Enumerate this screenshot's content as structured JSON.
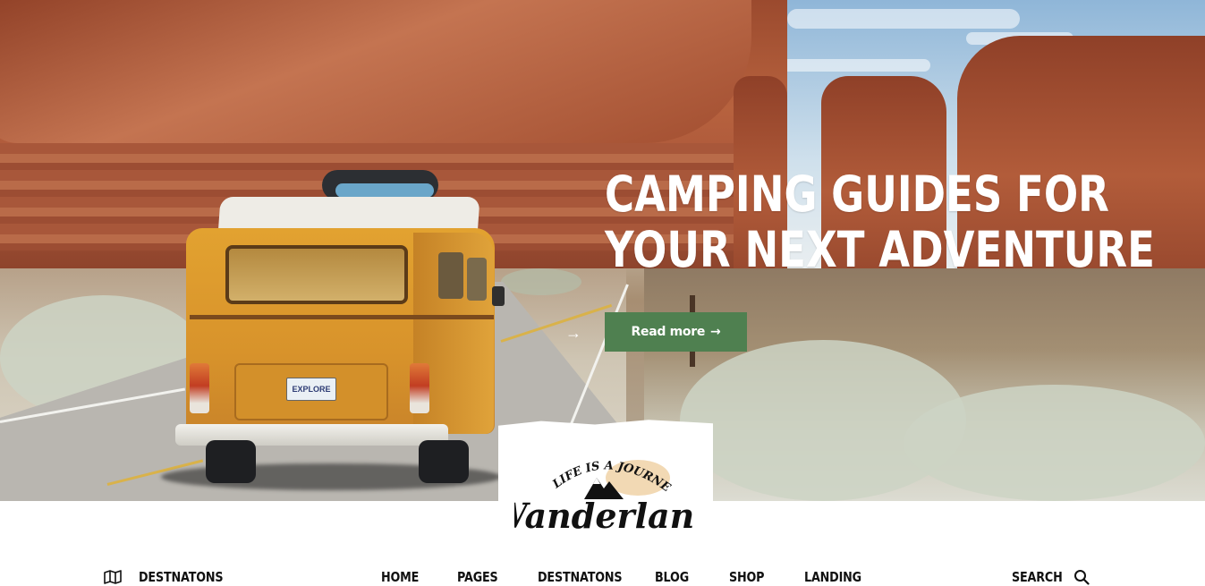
{
  "hero": {
    "headline_line1": "CAMPING GUIDES FOR",
    "headline_line2": "YOUR NEXT ADVENTURE",
    "read_more_label": "Read more",
    "read_more_icon": "arrow-right-icon",
    "prev_arrow_icon": "arrow-right-icon",
    "license_plate": "EXPLORE",
    "accent_color": "#4f8050"
  },
  "logo": {
    "tagline": "LIFE IS A JOURNEY",
    "brand": "Wanderland"
  },
  "nav": {
    "left": {
      "icon": "map-icon",
      "label": "DESTNATONS"
    },
    "items": [
      "HOME",
      "PAGES",
      "DESTNATONS",
      "BLOG",
      "SHOP",
      "LANDING"
    ],
    "search": {
      "label": "SEARCH",
      "icon": "search-icon"
    }
  }
}
